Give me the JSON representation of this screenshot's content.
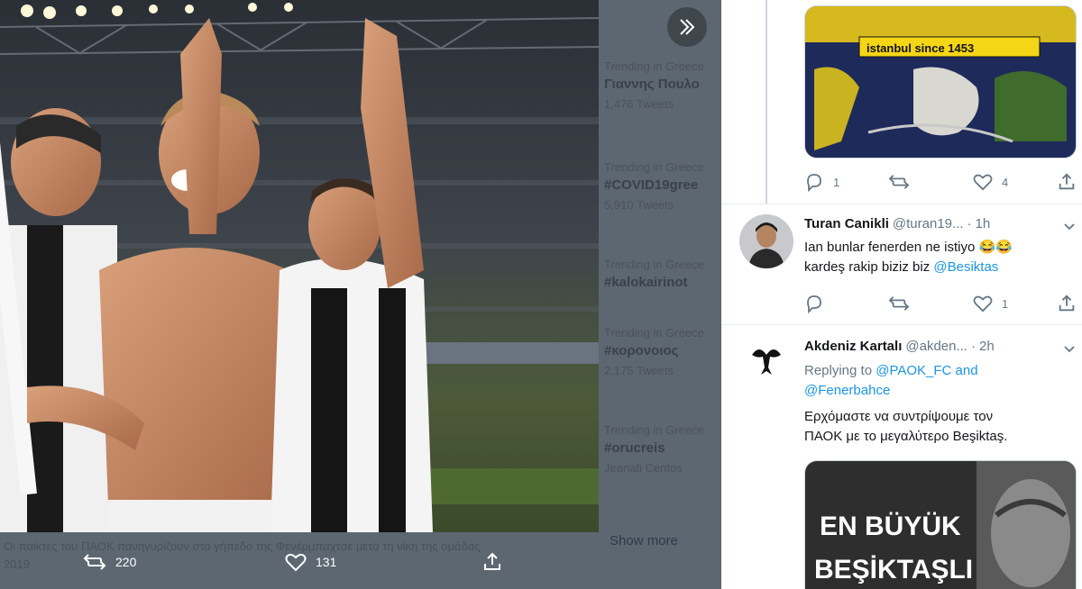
{
  "media": {
    "expand_label": "»",
    "caption_line1": "Οι παίκτες του ΠΑΟΚ πανηγυρίζουν στο γήπεδο της Φενέρμπαχτσε μετά τη νίκη της ομάδας",
    "caption_line2": "2019",
    "retweets": "220",
    "likes": "131"
  },
  "background_trends": [
    {
      "context": "Trending in Greece",
      "tag": "Γιαννης Πουλο",
      "count": "1,476 Tweets"
    },
    {
      "context": "Trending in Greece",
      "tag": "#COVID19gree",
      "count": "5,910 Tweets"
    },
    {
      "context": "Trending in Greece",
      "tag": "#kalokairinot",
      "count": ""
    },
    {
      "context": "Trending in Greece",
      "tag": "#κορονοιος",
      "count": "2,175 Tweets"
    },
    {
      "context": "Trending in Greece",
      "tag": "#orucreis",
      "count": "Jeanafi Ceritos"
    }
  ],
  "show_more": "Show more",
  "tweets": [
    {
      "replies": "1",
      "retweets": "",
      "likes": "4",
      "banner_text": "istanbul since 1453"
    },
    {
      "name": "Turan Canikli",
      "handle": "@turan19...",
      "time": "1h",
      "text_line1": "Ian bunlar fenerden ne istiyo 😂😂",
      "text_line2_prefix": "kardeş rakip biziz biz ",
      "mention": "@Besiktas",
      "replies": "",
      "retweets": "",
      "likes": "1"
    },
    {
      "name": "Akdeniz Kartalı",
      "handle": "@akden...",
      "time": "2h",
      "replying_prefix": "Replying to ",
      "replying_to_1": "@PAOK_FC and",
      "replying_to_2": "@Fenerbahce",
      "text_line1": "Ερχόμαστε να συντρίψουμε τον",
      "text_line2": "ΠΑΟΚ με το μεγαλύτερο Beşiktaş.",
      "poster_line1": "EN BÜYÜK",
      "poster_line2": "BEŞİKTAŞLI"
    }
  ],
  "colors": {
    "accent": "#1b95e0",
    "text": "#14171a",
    "muted": "#657786",
    "divider": "#e6ecf0",
    "overlay": "#5d6771"
  }
}
